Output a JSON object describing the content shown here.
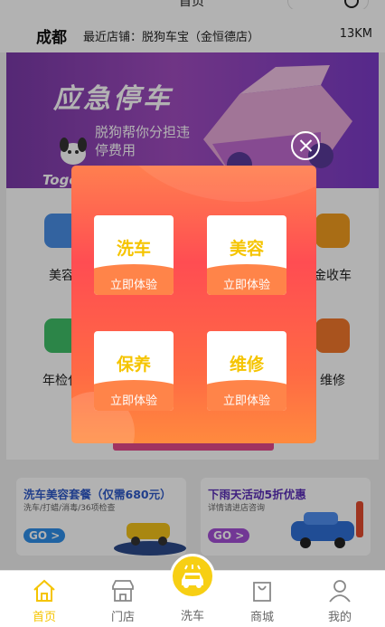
{
  "window": {
    "title": "首页"
  },
  "location": {
    "city": "成都",
    "shop_label": "最近店铺：脱狗车宝（金恒德店）",
    "distance": "13KM"
  },
  "banner": {
    "title": "应急停车",
    "subtitle": "脱狗帮你分担违停费用",
    "logo": "Togogo"
  },
  "services": [
    {
      "label": "美容",
      "color": "#4a8ee6"
    },
    {
      "label": "金收车",
      "color": "#f29c1f"
    },
    {
      "label": "年检代",
      "color": "#3fbf68"
    },
    {
      "label": "维修",
      "color": "#f2782c"
    }
  ],
  "promos": [
    {
      "title": "洗车美容套餐（仅需680元）",
      "subtitle": "洗车/打蜡/消毒/36项检查",
      "go": "GO >",
      "go_color": "#2f8fe8"
    },
    {
      "title": "下雨天活动5折优惠",
      "subtitle": "详情请进店咨询",
      "go": "GO >",
      "go_color": "#a44fd6"
    }
  ],
  "modal": {
    "cards": [
      {
        "title": "洗车",
        "action": "立即体验"
      },
      {
        "title": "美容",
        "action": "立即体验"
      },
      {
        "title": "保养",
        "action": "立即体验"
      },
      {
        "title": "维修",
        "action": "立即体验"
      }
    ]
  },
  "tabbar": {
    "items": [
      {
        "label": "首页",
        "icon": "home-icon"
      },
      {
        "label": "门店",
        "icon": "store-icon"
      },
      {
        "label": "洗车",
        "icon": "car-wash-icon"
      },
      {
        "label": "商城",
        "icon": "shopping-bag-icon"
      },
      {
        "label": "我的",
        "icon": "user-icon"
      }
    ],
    "active_color": "#f5c400"
  }
}
